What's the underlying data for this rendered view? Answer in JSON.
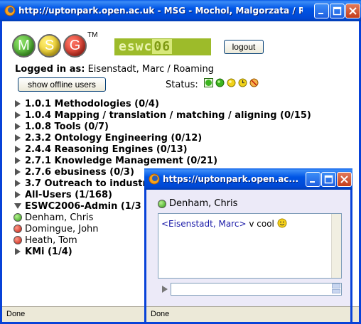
{
  "main_window": {
    "title": "http://uptonpark.open.ac.uk - MSG - Mochol, Malgorzata / Roa...",
    "status_text": "Done"
  },
  "logos": {
    "msg_letters": [
      "M",
      "S",
      "G"
    ],
    "trademark": "TM",
    "eswc_text": "eswc",
    "eswc_year": "06"
  },
  "header": {
    "logout_label": "logout",
    "logged_in_label": "Logged in as:",
    "logged_in_user": "Eisenstadt, Marc / Roaming",
    "offline_button_label": "show offline users",
    "status_label": "Status:",
    "status_icons": [
      "available-icon",
      "online-icon",
      "away-icon",
      "busy-icon",
      "do-not-disturb-icon"
    ]
  },
  "tree": [
    {
      "label": "1.0.1 Methodologies (0/4)",
      "expanded": false
    },
    {
      "label": "1.0.4 Mapping / translation / matching / aligning (0/15)",
      "expanded": false
    },
    {
      "label": "1.0.8 Tools (0/7)",
      "expanded": false
    },
    {
      "label": "2.3.2 Ontology Engineering (0/12)",
      "expanded": false
    },
    {
      "label": "2.4.4 Reasoning Engines (0/13)",
      "expanded": false
    },
    {
      "label": "2.7.1 Knowledge Management (0/21)",
      "expanded": false
    },
    {
      "label": "2.7.6 ebusiness (0/3)",
      "expanded": false
    },
    {
      "label": "3.7 Outreach to industr",
      "expanded": false
    },
    {
      "label": "All-Users (1/168)",
      "expanded": false
    },
    {
      "label": "ESWC2006-Admin (1/3",
      "expanded": true
    },
    {
      "label": "KMi (1/4)",
      "expanded": false
    }
  ],
  "admin_users": [
    {
      "name": "Denham, Chris",
      "status": "online"
    },
    {
      "name": "Domingue, John",
      "status": "offline"
    },
    {
      "name": "Heath, Tom",
      "status": "offline"
    }
  ],
  "chat_window": {
    "title": "https://uptonpark.open.ac....",
    "contact_name": "Denham, Chris",
    "messages": [
      {
        "sender": "<Eisenstadt, Marc>",
        "text": "v cool"
      }
    ],
    "input_value": "",
    "status_text": "Done"
  },
  "colors": {
    "titlebar_blue": "#0055e5",
    "online_green": "#2e9a14",
    "offline_red": "#c31a0c",
    "eswc_green": "#9dbb2a"
  }
}
